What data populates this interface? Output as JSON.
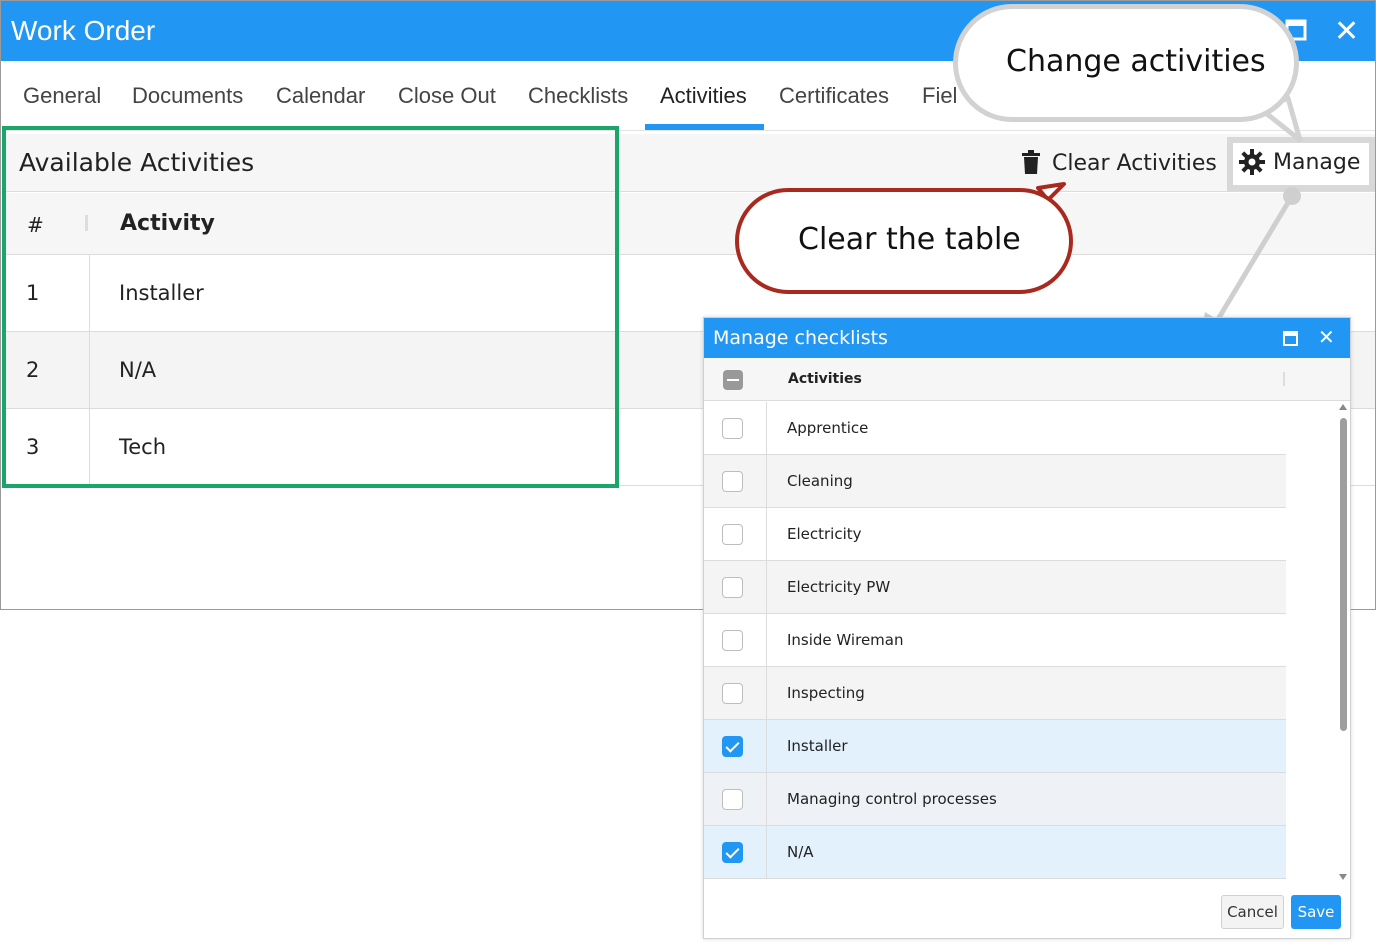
{
  "window": {
    "title": "Work Order",
    "maximize_icon": "maximize-icon",
    "close_icon": "close-icon",
    "close_glyph": "✕"
  },
  "tabs": [
    {
      "label": "General"
    },
    {
      "label": "Documents"
    },
    {
      "label": "Calendar"
    },
    {
      "label": "Close Out"
    },
    {
      "label": "Checklists"
    },
    {
      "label": "Activities",
      "active": true
    },
    {
      "label": "Certificates"
    },
    {
      "label": "Fiel"
    }
  ],
  "panel": {
    "title": "Available Activities",
    "clear_label": "Clear Activities",
    "clear_icon": "trash-icon",
    "manage_label": "Manage",
    "manage_icon": "gear-icon"
  },
  "grid": {
    "col_num": "#",
    "col_activity": "Activity",
    "rows": [
      {
        "num": "1",
        "activity": "Installer"
      },
      {
        "num": "2",
        "activity": "N/A"
      },
      {
        "num": "3",
        "activity": "Tech"
      }
    ]
  },
  "callouts": {
    "change": "Change activities",
    "clear": "Clear the table"
  },
  "dialog": {
    "title": "Manage checklists",
    "close_glyph": "✕",
    "column_header": "Activities",
    "items": [
      {
        "label": "Apprentice",
        "checked": false
      },
      {
        "label": "Cleaning",
        "checked": false
      },
      {
        "label": "Electricity",
        "checked": false
      },
      {
        "label": "Electricity PW",
        "checked": false
      },
      {
        "label": "Inside Wireman",
        "checked": false
      },
      {
        "label": "Inspecting",
        "checked": false
      },
      {
        "label": "Installer",
        "checked": true
      },
      {
        "label": "Managing control processes",
        "checked": false
      },
      {
        "label": "N/A",
        "checked": true
      }
    ],
    "cancel_label": "Cancel",
    "save_label": "Save"
  },
  "colors": {
    "accent": "#2196f3",
    "highlight_frame": "#1aa66a",
    "callout_red": "#a82a1e",
    "callout_grey": "#d2d2d2"
  }
}
